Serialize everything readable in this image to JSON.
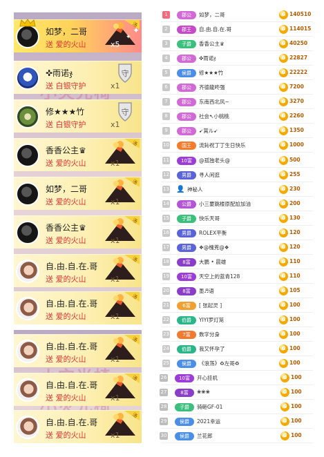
{
  "feed": {
    "watermark": "小灾光椅",
    "cards": [
      {
        "name": "如梦，二哥",
        "gift": "送 爱的火山",
        "count": "x5",
        "avatar": "dark",
        "hot": true,
        "icon": "volcano-icon",
        "crown": true
      },
      {
        "name": "✜雨诺ჯ",
        "gift": "送 白银守护",
        "count": "x1",
        "avatar": "blue",
        "hot": false,
        "icon": "shield-icon"
      },
      {
        "name": "修★★★竹",
        "gift": "送 白银守护",
        "count": "x1",
        "avatar": "green",
        "hot": false,
        "icon": "shield-icon"
      },
      {
        "name": "香香公主♛",
        "gift": "送 爱的火山",
        "count": "x1",
        "avatar": "dark",
        "hot": false,
        "icon": "volcano-icon"
      },
      {
        "name": "如梦，二哥",
        "gift": "送 爱的火山",
        "count": "x1",
        "avatar": "dark",
        "hot": false,
        "icon": "volcano-icon"
      },
      {
        "name": "香香公主♛",
        "gift": "送 爱的火山",
        "count": "x1",
        "avatar": "dark",
        "hot": false,
        "icon": "volcano-icon"
      },
      {
        "name": "自.由.自.在.哥",
        "gift": "送 爱的火山",
        "count": "x1",
        "avatar": "girl",
        "hot": false,
        "icon": "volcano-icon"
      },
      {
        "name": "自.由.自.在.哥",
        "gift": "送 爱的火山",
        "count": "x1",
        "avatar": "girl",
        "hot": false,
        "icon": "volcano-icon"
      },
      {
        "name": "自.由.自.在.哥",
        "gift": "送 爱的火山",
        "count": "x1",
        "avatar": "girl",
        "hot": false,
        "icon": "volcano-icon"
      },
      {
        "name": "自.由.自.在.哥",
        "gift": "送 爱的火山",
        "count": "x1",
        "avatar": "girl",
        "hot": false,
        "icon": "volcano-icon"
      },
      {
        "name": "自.由.自.在.哥",
        "gift": "送 爱的火山",
        "count": "x1",
        "avatar": "girl",
        "hot": false,
        "icon": "volcano-icon"
      }
    ]
  },
  "ranking": [
    {
      "rank": "1",
      "badge": "郡公",
      "badge_color": "#d26ad6",
      "name": "如梦，二哥",
      "value": "140510"
    },
    {
      "rank": "2",
      "badge": "郡王",
      "badge_color": "#c64ac8",
      "name": "自.由.自.在.哥",
      "value": "114015"
    },
    {
      "rank": "3",
      "badge": "子爵",
      "badge_color": "#3bbf7c",
      "name": "香香公主♛",
      "value": "40250"
    },
    {
      "rank": "4",
      "badge": "郡公",
      "badge_color": "#d26ad6",
      "name": "✜雨诺ჯ",
      "value": "22827"
    },
    {
      "rank": "5",
      "badge": "侯爵",
      "badge_color": "#4a8ee8",
      "name": "修★★★竹",
      "value": "22222"
    },
    {
      "rank": "6",
      "badge": "郡公",
      "badge_color": "#d26ad6",
      "name": "齐德龍咚强",
      "value": "7200"
    },
    {
      "rank": "7",
      "badge": "郡公",
      "badge_color": "#d26ad6",
      "name": "东南西北风~",
      "value": "3270"
    },
    {
      "rank": "8",
      "badge": "郡公",
      "badge_color": "#d26ad6",
      "name": "社会➷小桃桃",
      "value": "2260"
    },
    {
      "rank": "9",
      "badge": "郡公",
      "badge_color": "#d26ad6",
      "name": "➹賞ル➹",
      "value": "1350"
    },
    {
      "rank": "10",
      "badge": "国王",
      "badge_color": "#f57a2a",
      "name": "流鈊祝丁丁生日快乐",
      "value": "1000"
    },
    {
      "rank": "11",
      "badge": "10富",
      "badge_color": "#9b3dd6",
      "name": "@孤独老头@",
      "value": "500"
    },
    {
      "rank": "12",
      "badge": "男爵",
      "badge_color": "#5a64d6",
      "name": "寻人闲逛",
      "value": "255"
    },
    {
      "rank": "13",
      "badge": "",
      "badge_color": "",
      "name": "神秘人",
      "value": "230"
    },
    {
      "rank": "14",
      "badge": "公爵",
      "badge_color": "#b455d6",
      "name": "小三要跳楼原配尬加油",
      "value": "200"
    },
    {
      "rank": "15",
      "badge": "子爵",
      "badge_color": "#3bbf7c",
      "name": "快乐天哥",
      "value": "130"
    },
    {
      "rank": "16",
      "badge": "男爵",
      "badge_color": "#5a64d6",
      "name": "ROLEX平衡",
      "value": "120"
    },
    {
      "rank": "17",
      "badge": "男爵",
      "badge_color": "#5a64d6",
      "name": "❖@槐茺@❖",
      "value": "120"
    },
    {
      "rank": "18",
      "badge": "8富",
      "badge_color": "#8a3dc6",
      "name": "大鹏 • 晨雄",
      "value": "110"
    },
    {
      "rank": "19",
      "badge": "10富",
      "badge_color": "#9b3dd6",
      "name": "天空上的蓝青128",
      "value": "110"
    },
    {
      "rank": "20",
      "badge": "8富",
      "badge_color": "#8a3dc6",
      "name": "墨♬语",
      "value": "105"
    },
    {
      "rank": "21",
      "badge": "6富",
      "badge_color": "#f0a030",
      "name": "[ 张起灵 ]",
      "value": "100"
    },
    {
      "rank": "22",
      "badge": "伯爵",
      "badge_color": "#2db58a",
      "name": "YIYI罗灯笼",
      "value": "100"
    },
    {
      "rank": "23",
      "badge": "7富",
      "badge_color": "#f07a30",
      "name": "数字分身",
      "value": "100"
    },
    {
      "rank": "24",
      "badge": "伯爵",
      "badge_color": "#2db58a",
      "name": "我又怀孕了",
      "value": "100"
    },
    {
      "rank": "25",
      "badge": "侯爵",
      "badge_color": "#4a8ee8",
      "name": "《浪荡》♻左哥♻",
      "value": "100"
    },
    {
      "rank": "26",
      "badge": "10富",
      "badge_color": "#9b3dd6",
      "name": "开心挂机",
      "value": "100"
    },
    {
      "rank": "27",
      "badge": "8富",
      "badge_color": "#8a3dc6",
      "name": "❀❀❀",
      "value": "100"
    },
    {
      "rank": "28",
      "badge": "子爵",
      "badge_color": "#3bbf7c",
      "name": "骑砸GF-01",
      "value": "100"
    },
    {
      "rank": "29",
      "badge": "侯爵",
      "badge_color": "#4a8ee8",
      "name": "2021幸运",
      "value": "100"
    },
    {
      "rank": "30",
      "badge": "侯爵",
      "badge_color": "#4a8ee8",
      "name": "兰花郎",
      "value": "100"
    }
  ],
  "coin_glyph": "G"
}
